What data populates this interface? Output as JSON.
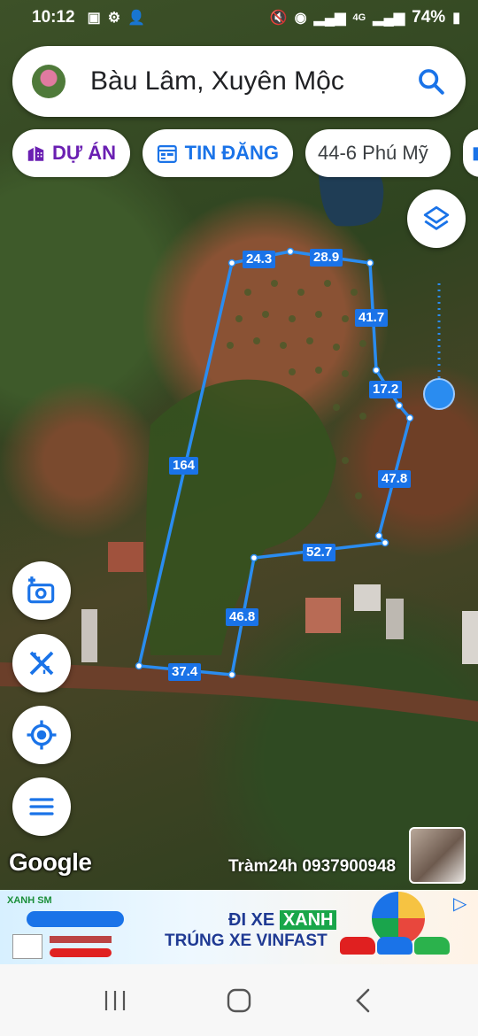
{
  "status_bar": {
    "time": "10:12",
    "network": "4G",
    "battery": "74%"
  },
  "search": {
    "query": "Bàu Lâm, Xuyên Mộc"
  },
  "chips": {
    "du_an": "DỰ ÁN",
    "tin_dang": "TIN ĐĂNG",
    "place": "44-6 Phú Mỹ"
  },
  "measurements": {
    "m1": "24.3",
    "m2": "28.9",
    "m3": "41.7",
    "m4": "17.2",
    "m5": "47.8",
    "m6": "52.7",
    "m7": "46.8",
    "m8": "37.4",
    "m9": "164"
  },
  "map": {
    "attribution": "Google",
    "watermark": "Tràm24h 0937900948"
  },
  "ad": {
    "brand": "XANH SM",
    "title_prefix": "ĐI XE",
    "title_highlight": "XANH",
    "title_line2": "TRÚNG XE VINFAST"
  },
  "colors": {
    "accent_blue": "#1a73e8",
    "project_purple": "#6a1fb2"
  }
}
